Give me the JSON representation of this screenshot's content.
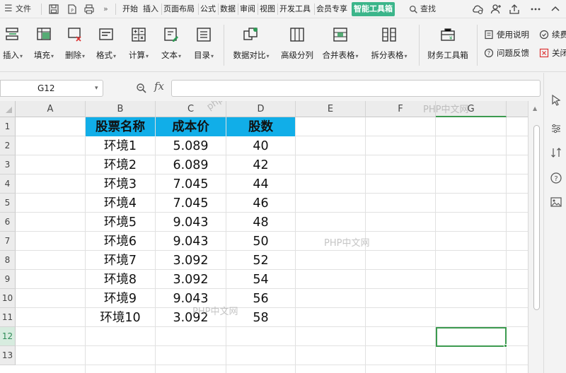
{
  "menubar": {
    "hamburger": "☰",
    "file_label": "文件",
    "more": "»",
    "tabs": [
      "开始",
      "插入",
      "页面布局",
      "公式",
      "数据",
      "审阅",
      "视图",
      "开发工具",
      "会员专享",
      "智能工具箱"
    ],
    "active_tab_index": 9,
    "search_label": "查找",
    "accent_color": "#3bb58a"
  },
  "ribbon": {
    "buttons": [
      {
        "label": "插入",
        "icon": "insert-rows-icon",
        "caret": true
      },
      {
        "label": "填充",
        "icon": "fill-icon",
        "caret": true
      },
      {
        "label": "删除",
        "icon": "delete-cells-icon",
        "caret": true
      },
      {
        "label": "格式",
        "icon": "format-icon",
        "caret": true
      },
      {
        "label": "计算",
        "icon": "calculate-icon",
        "caret": true
      },
      {
        "label": "文本",
        "icon": "text-icon",
        "caret": true
      },
      {
        "label": "目录",
        "icon": "contents-icon",
        "caret": true
      },
      {
        "label": "数据对比",
        "icon": "data-compare-icon",
        "caret": true
      },
      {
        "label": "高级分列",
        "icon": "advanced-split-icon",
        "caret": false
      },
      {
        "label": "合并表格",
        "icon": "merge-table-icon",
        "caret": true
      },
      {
        "label": "拆分表格",
        "icon": "split-table-icon",
        "caret": true
      },
      {
        "label": "财务工具箱",
        "icon": "finance-toolbox-icon",
        "caret": false
      }
    ],
    "small": [
      {
        "label": "使用说明",
        "icon": "manual-icon"
      },
      {
        "label": "续费",
        "icon": "renew-icon"
      },
      {
        "label": "问题反馈",
        "icon": "feedback-icon"
      },
      {
        "label": "关闭",
        "icon": "close-icon"
      }
    ]
  },
  "formula_bar": {
    "name_box": "G12",
    "fx_label": "fx",
    "formula": ""
  },
  "sheet": {
    "columns": [
      "A",
      "B",
      "C",
      "D",
      "E",
      "F",
      "G"
    ],
    "rows": [
      "1",
      "2",
      "3",
      "4",
      "5",
      "6",
      "7",
      "8",
      "9",
      "10",
      "11",
      "12",
      "13"
    ],
    "selected_row_index": 11,
    "header_fill": "#11aee8",
    "selection_color": "#3c9a4f",
    "table": {
      "headers": [
        "股票名称",
        "成本价",
        "股数"
      ],
      "rows": [
        [
          "环境1",
          "5.089",
          "40"
        ],
        [
          "环境2",
          "6.089",
          "42"
        ],
        [
          "环境3",
          "7.045",
          "44"
        ],
        [
          "环境4",
          "7.045",
          "46"
        ],
        [
          "环境5",
          "9.043",
          "48"
        ],
        [
          "环境6",
          "9.043",
          "50"
        ],
        [
          "环境7",
          "3.092",
          "52"
        ],
        [
          "环境8",
          "3.092",
          "54"
        ],
        [
          "环境9",
          "9.043",
          "56"
        ],
        [
          "环境10",
          "3.092",
          "58"
        ]
      ]
    }
  },
  "watermarks": [
    "PHP中文网",
    "php.cn",
    "PHP中文网",
    "PHP中文网",
    "php.cn",
    "PHP中文网"
  ]
}
